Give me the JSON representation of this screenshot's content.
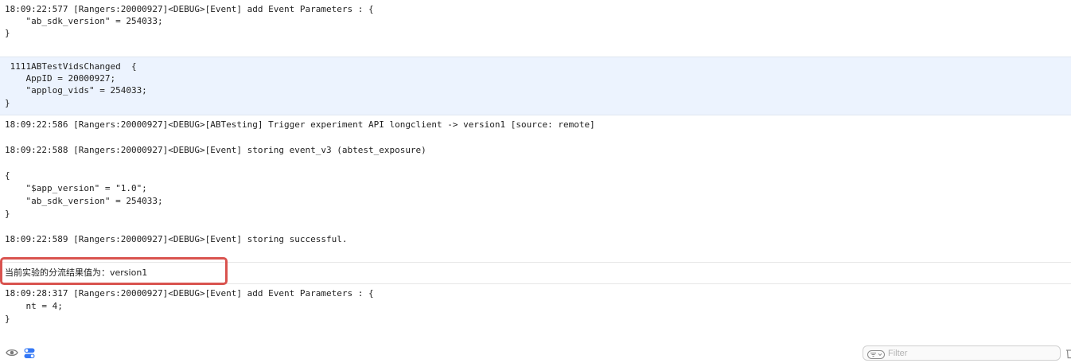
{
  "console": {
    "entries": [
      {
        "lines": [
          "18:09:22:577 [Rangers:20000927]<DEBUG>[Event] add Event Parameters : {",
          "    \"ab_sdk_version\" = 254033;",
          "}"
        ]
      },
      {
        "lines": [
          " 1111ABTestVidsChanged  {",
          "    AppID = 20000927;",
          "    \"applog_vids\" = 254033;",
          "}"
        ]
      },
      {
        "lines": [
          "18:09:22:586 [Rangers:20000927]<DEBUG>[ABTesting] Trigger experiment API longclient -> version1 [source: remote]",
          "",
          "18:09:22:588 [Rangers:20000927]<DEBUG>[Event] storing event_v3 (abtest_exposure)",
          "",
          "{",
          "    \"$app_version\" = \"1.0\";",
          "    \"ab_sdk_version\" = 254033;",
          "}",
          "",
          "18:09:22:589 [Rangers:20000927]<DEBUG>[Event] storing successful."
        ]
      },
      {
        "lines": [
          "当前实验的分流结果值为：version1"
        ]
      },
      {
        "lines": [
          "18:09:28:317 [Rangers:20000927]<DEBUG>[Event] add Event Parameters : {",
          "    nt = 4;",
          "}"
        ]
      }
    ]
  },
  "toolbar": {
    "filter_placeholder": "Filter"
  },
  "colors": {
    "highlight_bg": "#ecf3fe",
    "annotation_border": "#d9534f",
    "toggle_blue": "#3478f6"
  }
}
